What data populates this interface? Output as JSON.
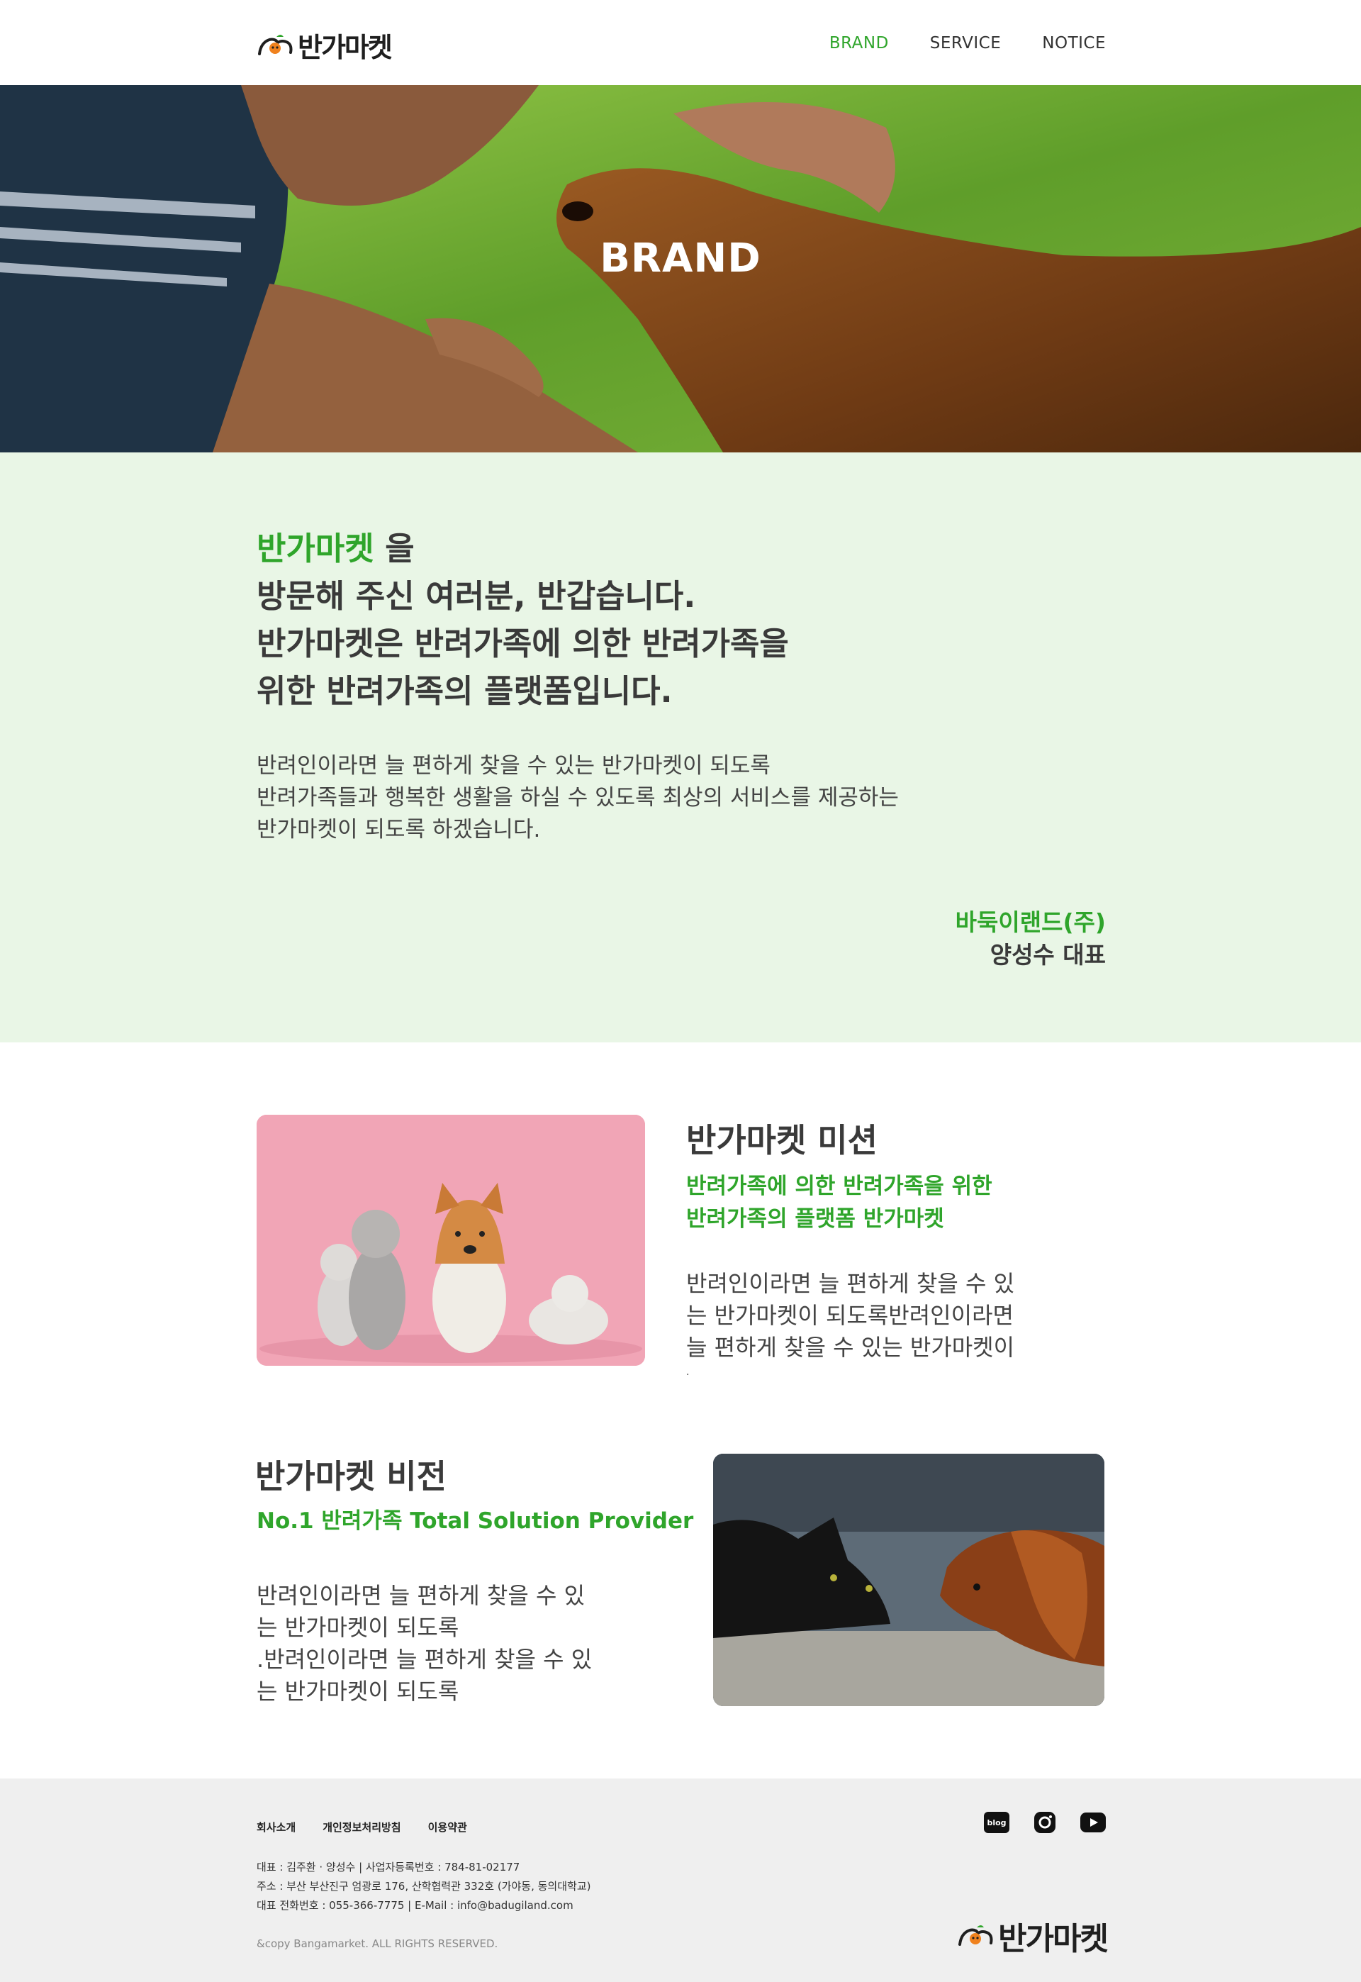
{
  "header": {
    "logo_text": "반가마켓",
    "nav": [
      {
        "label": "BRAND",
        "active": true
      },
      {
        "label": "SERVICE",
        "active": false
      },
      {
        "label": "NOTICE",
        "active": false
      }
    ]
  },
  "hero": {
    "title": "BRAND"
  },
  "intro": {
    "brand_word": "반가마켓",
    "line1_suffix": " 을",
    "line2": "방문해 주신 여러분, 반갑습니다.",
    "line3": "반가마켓은 반려가족에 의한 반려가족을",
    "line4": "위한 반려가족의 플랫폼입니다.",
    "body": [
      "반려인이라면 늘 편하게 찾을 수 있는 반가마켓이 되도록",
      "반려가족들과 행복한 생활을 하실 수 있도록 최상의 서비스를 제공하는",
      "반가마켓이 되도록 하겠습니다."
    ],
    "company": "바둑이랜드(주)",
    "ceo": "양성수 대표"
  },
  "mission": {
    "title": "반가마켓 미션",
    "subtitle": [
      "반려가족에 의한 반려가족을 위한",
      "반려가족의 플랫폼 반가마켓"
    ],
    "body": [
      "반려인이라면 늘 편하게 찾을 수 있",
      "는 반가마켓이 되도록반려인이라면",
      "늘 편하게 찾을 수 있는 반가마켓이",
      "."
    ]
  },
  "vision": {
    "title": "반가마켓 비전",
    "subtitle": "No.1 반려가족 Total Solution Provider",
    "body": [
      "반려인이라면 늘 편하게 찾을 수 있",
      "는 반가마켓이 되도록",
      ".반려인이라면 늘 편하게 찾을 수 있",
      "는 반가마켓이 되도록"
    ]
  },
  "footer": {
    "links": [
      "회사소개",
      "개인정보처리방침",
      "이용약관"
    ],
    "info": [
      "대표 : 김주환 · 양성수 | 사업자등록번호 : 784-81-02177",
      "주소 : 부산 부산진구 엄광로 176, 산학협력관 332호 (가야동, 동의대학교)",
      "대표 전화번호 : 055-366-7775 | E-Mail : info@badugiland.com"
    ],
    "copyright": "&copy Bangamarket. ALL RIGHTS RESERVED.",
    "social": [
      {
        "icon": "blog-icon",
        "label": "blog"
      },
      {
        "icon": "instagram-icon",
        "label": ""
      },
      {
        "icon": "youtube-icon",
        "label": ""
      }
    ],
    "logo_text": "반가마켓"
  },
  "colors": {
    "accent": "#2fa52b",
    "intro_bg": "#e9f6e6",
    "footer_bg": "#efefef",
    "text": "#3a3a3a"
  }
}
